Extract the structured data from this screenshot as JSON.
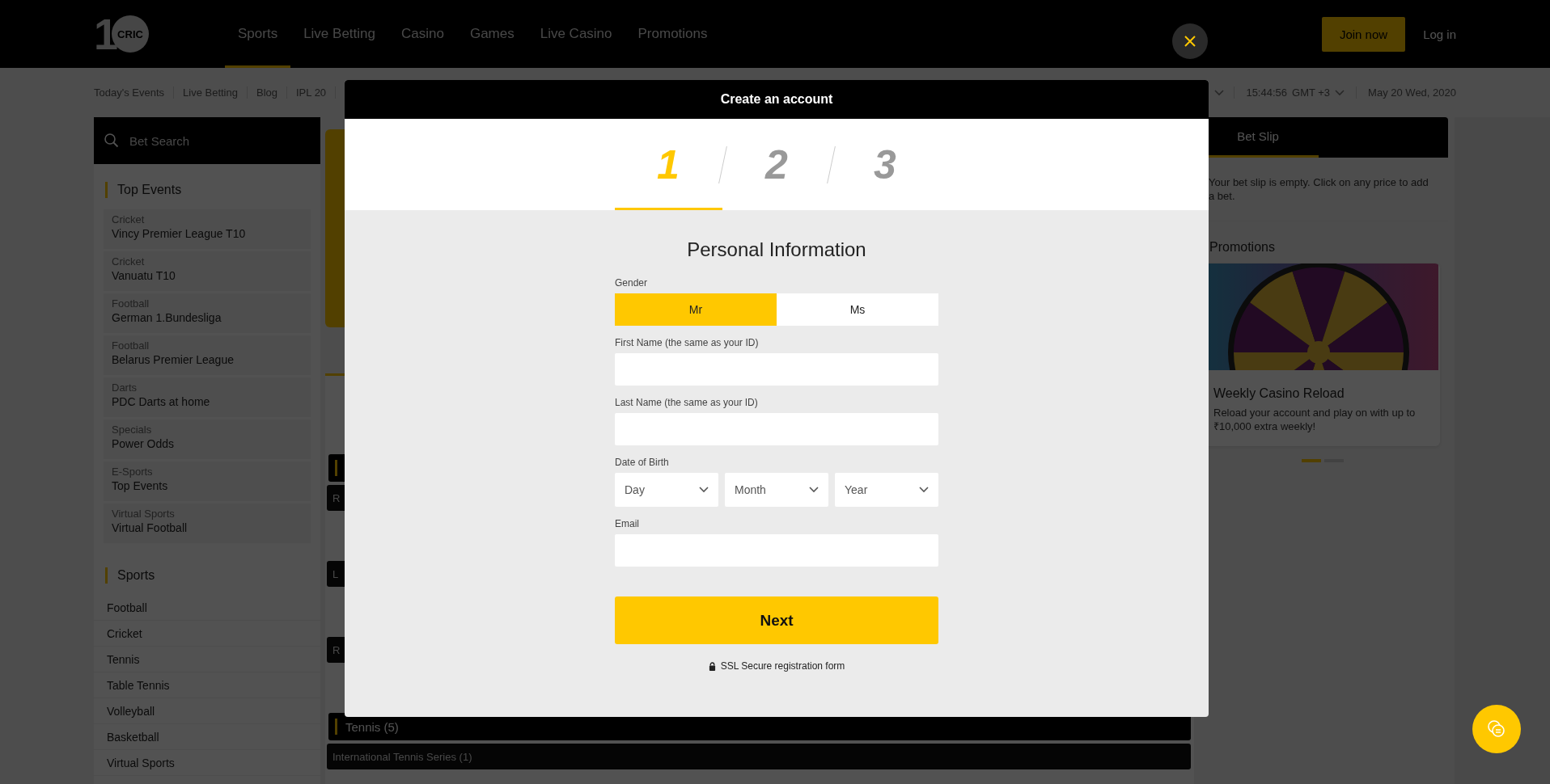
{
  "header": {
    "logo": {
      "mark": "1",
      "text": "CRIC"
    },
    "nav": [
      {
        "label": "Sports",
        "selected": true
      },
      {
        "label": "Live Betting",
        "selected": false
      },
      {
        "label": "Casino",
        "selected": false
      },
      {
        "label": "Games",
        "selected": false
      },
      {
        "label": "Live Casino",
        "selected": false
      },
      {
        "label": "Promotions",
        "selected": false
      }
    ],
    "join_button": "Join now",
    "login_link": "Log in"
  },
  "subnav": {
    "links": [
      "Today's Events",
      "Live Betting",
      "Blog",
      "IPL 20"
    ],
    "time": "15:44:56",
    "timezone": "GMT +3",
    "date": "May 20 Wed, 2020"
  },
  "sidebar": {
    "search_placeholder": "Bet Search",
    "top_events_title": "Top Events",
    "top_events": [
      {
        "sport": "Cricket",
        "event": "Vincy Premier League T10"
      },
      {
        "sport": "Cricket",
        "event": "Vanuatu T10"
      },
      {
        "sport": "Football",
        "event": "German 1.Bundesliga"
      },
      {
        "sport": "Football",
        "event": "Belarus Premier League"
      },
      {
        "sport": "Darts",
        "event": "PDC Darts at home"
      },
      {
        "sport": "Specials",
        "event": "Power Odds"
      },
      {
        "sport": "E-Sports",
        "event": "Top Events"
      },
      {
        "sport": "Virtual Sports",
        "event": "Virtual Football"
      }
    ],
    "sports_title": "Sports",
    "sports": [
      "Football",
      "Cricket",
      "Tennis",
      "Table Tennis",
      "Volleyball",
      "Basketball",
      "Virtual Sports"
    ]
  },
  "center": {
    "rows": [
      {
        "kind": "section"
      },
      {
        "kind": "league",
        "text": "R"
      },
      {
        "kind": "league",
        "text": "L"
      },
      {
        "kind": "league",
        "text": "R"
      },
      {
        "kind": "section",
        "text": "Tennis (5)"
      },
      {
        "kind": "league",
        "text": "International Tennis Series (1)"
      }
    ]
  },
  "betslip": {
    "tab": "Bet Slip",
    "message": "Your bet slip is empty. Click on any price to add a bet."
  },
  "promotions": {
    "title": "Promotions",
    "cards": [
      {
        "kind": "picture",
        "title": "Weekly Casino Reload",
        "text": "Reload your account and play on with up to ₹10,000 extra weekly!"
      }
    ],
    "pager": [
      {
        "selected": true
      },
      {
        "selected": false
      }
    ]
  },
  "modal": {
    "title": "Create an account",
    "steps": [
      {
        "label": "1",
        "selected": true
      },
      {
        "label": "2",
        "selected": false
      },
      {
        "label": "3",
        "selected": false
      }
    ],
    "heading": "Personal Information",
    "gender": {
      "label": "Gender",
      "options": [
        {
          "label": "Mr",
          "selected": true
        },
        {
          "label": "Ms",
          "selected": false
        }
      ]
    },
    "first_name": {
      "label": "First Name (the same as your ID)"
    },
    "last_name": {
      "label": "Last Name (the same as your ID)"
    },
    "birth": {
      "label": "Date of Birth",
      "selects": [
        {
          "placeholder": "Day"
        },
        {
          "placeholder": "Month"
        },
        {
          "placeholder": "Year"
        }
      ]
    },
    "email": {
      "label": "Email"
    },
    "next_button": "Next",
    "secure_note": "SSL Secure registration form"
  }
}
